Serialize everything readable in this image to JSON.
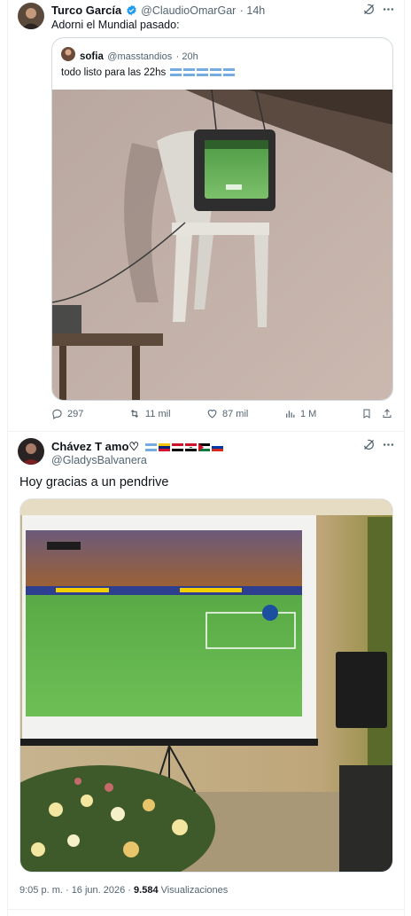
{
  "tweet": {
    "author_name": "Turco García",
    "author_handle": "@ClaudioOmarGar",
    "time": "· 14h",
    "text": "Adorni el Mundial pasado:",
    "quoted": {
      "author_name": "sofia",
      "author_handle": "@masstandios",
      "time": "· 20h",
      "text": "todo listo para las 22hs",
      "flags": [
        "argentina-flag",
        "argentina-flag",
        "argentina-flag",
        "argentina-flag",
        "argentina-flag"
      ]
    },
    "stats": {
      "replies": "297",
      "reposts": "11 mil",
      "likes": "87 mil",
      "views": "1 M"
    }
  },
  "reply": {
    "author_name": "Chávez T amo♡",
    "author_handle": "@GladysBalvanera",
    "flags": [
      "argentina-flag",
      "venezuela-flag",
      "egypt-flag",
      "iraq-flag",
      "palestine-flag",
      "russia-flag"
    ],
    "text": "Hoy gracias a un pendrive",
    "timestamp": "9:05 p. m. · 16 jun. 2026 ·",
    "views_count": "9.584",
    "views_label": "Visualizaciones"
  },
  "colors": {
    "verified": "#1d9bf0",
    "secondary_text": "#536471",
    "border": "#cfd9de"
  }
}
